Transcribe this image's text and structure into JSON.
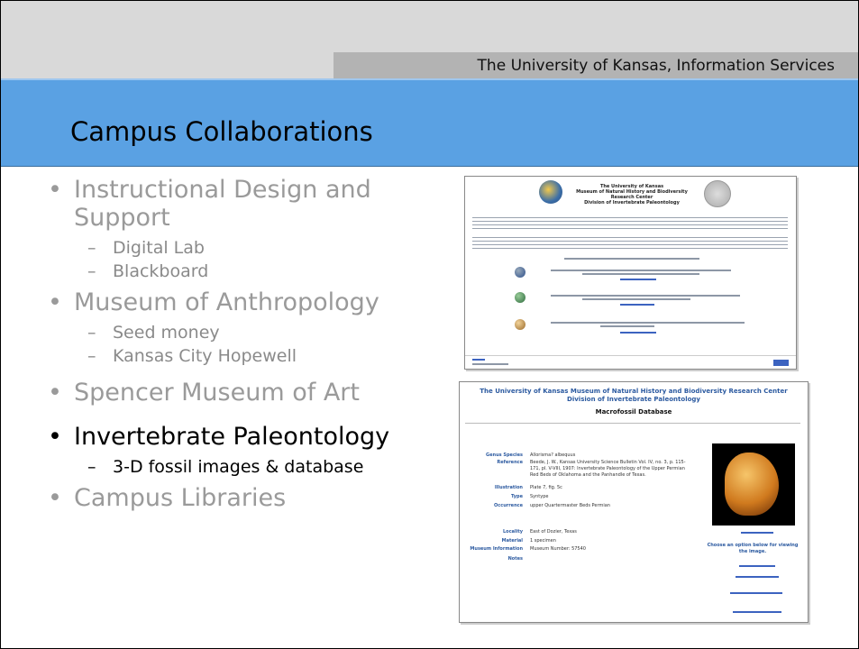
{
  "header": {
    "organization": "The University of Kansas, Information Services",
    "title": "Campus Collaborations"
  },
  "bullets": [
    {
      "label": "Instructional Design and Support",
      "active": false,
      "sub": [
        {
          "label": "Digital Lab"
        },
        {
          "label": "Blackboard"
        }
      ]
    },
    {
      "label": "Museum of Anthropology",
      "active": false,
      "sub": [
        {
          "label": "Seed money"
        },
        {
          "label": "Kansas City Hopewell"
        }
      ]
    },
    {
      "label": "Spencer Museum of Art",
      "active": false,
      "sub": []
    },
    {
      "label": "Invertebrate Paleontology",
      "active": true,
      "sub": [
        {
          "label": "3-D fossil images & database"
        }
      ]
    },
    {
      "label": "Campus Libraries",
      "active": false,
      "sub": []
    }
  ],
  "screenshot_top": {
    "header_line1": "The University of Kansas",
    "header_line2": "Museum of Natural History and Biodiversity Research Center",
    "header_line3": "Division of Invertebrate Paleontology"
  },
  "screenshot_bottom": {
    "title_line1": "The University of Kansas Museum of Natural History and Biodiversity Research Center",
    "title_line2": "Division of Invertebrate Paleontology",
    "subtitle": "Macrofossil Database",
    "fields": [
      {
        "label": "Genus Species",
        "value": "Allorisma? albequus"
      },
      {
        "label": "Reference",
        "value": "Beede, J. W., Kansas University Science Bulletin Vol. IV, no. 3, p. 115- 171, pl. V-VIII, 1907: Invertebrate Paleontology of the Upper Permian Red Beds of Oklahoma and the Panhandle of Texas."
      },
      {
        "label": "Illustration",
        "value": "Plate 7, fig. 5c"
      },
      {
        "label": "Type",
        "value": "Syntype"
      },
      {
        "label": "Occurrence",
        "value": "upper Quartermaster Beds Permian"
      },
      {
        "label": "Locality",
        "value": "East of Dozier, Texas"
      },
      {
        "label": "Material",
        "value": "1 specimen"
      },
      {
        "label": "Museum Information",
        "value": "Museum Number: 57540"
      },
      {
        "label": "Notes",
        "value": ""
      }
    ],
    "classification_link": "Classification",
    "choose_text": "Choose an option below for viewing the image."
  }
}
